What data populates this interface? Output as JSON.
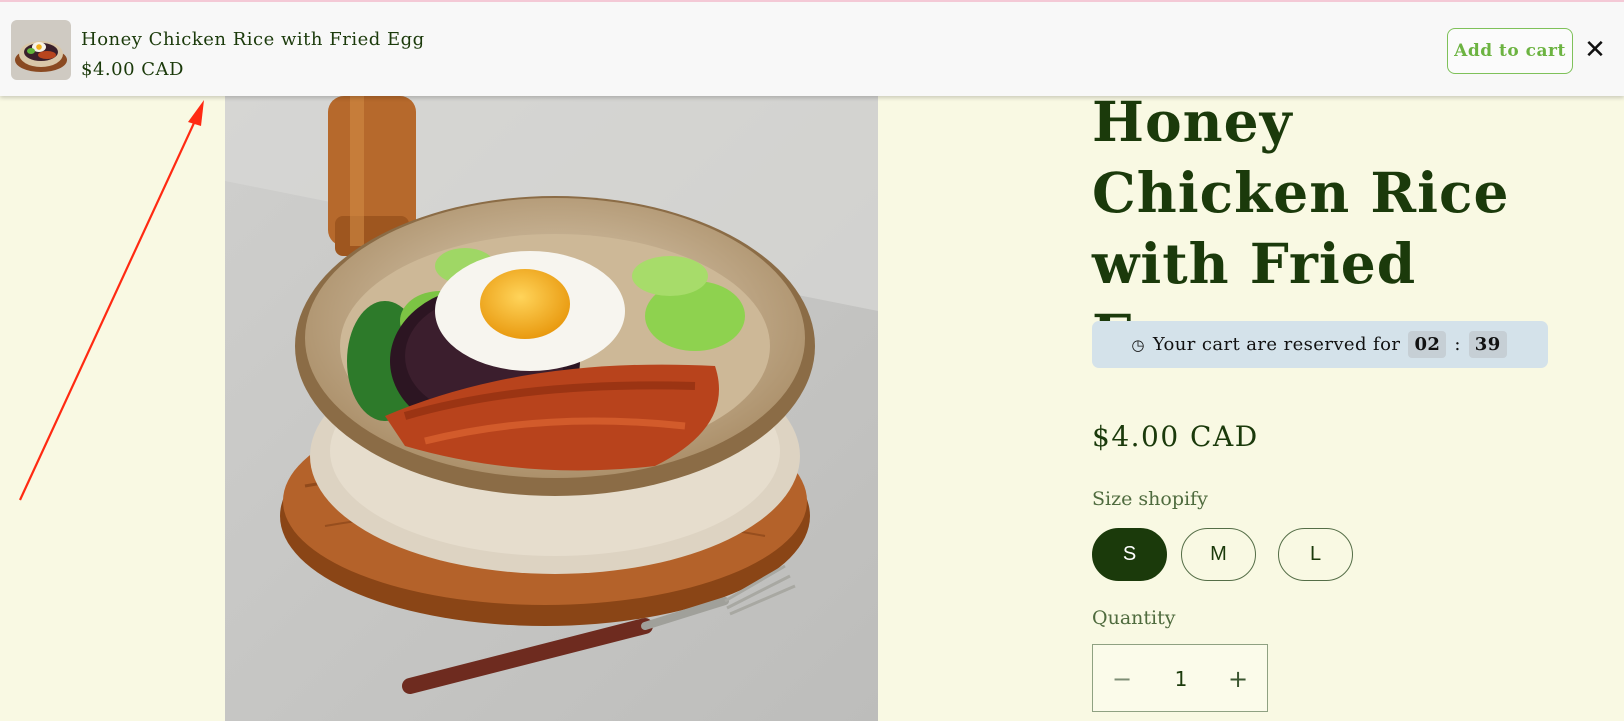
{
  "sticky_bar": {
    "title": "Honey Chicken Rice with Fried Egg",
    "price": "$4.00 CAD",
    "add_to_cart_label": "Add to cart",
    "close_icon": "close-icon",
    "close_glyph": "✕"
  },
  "product": {
    "title": "Honey Chicken Rice with Fried Egg",
    "price": "$4.00 CAD",
    "image_description": "rice-bowl-photo"
  },
  "reservation": {
    "text": "Your cart are reserved for",
    "minutes": "02",
    "separator": ":",
    "seconds": "39",
    "icon": "clock-icon",
    "clock_glyph": "◷"
  },
  "size": {
    "label": "Size shopify",
    "options": [
      "S",
      "M",
      "L"
    ],
    "selected": "S"
  },
  "quantity": {
    "label": "Quantity",
    "value": "1",
    "decrement_glyph": "−",
    "increment_glyph": "+"
  },
  "colors": {
    "background": "#f9f9e3",
    "text_dark_green": "#1b3a0b",
    "accent_green": "#6cb341",
    "reserve_bg": "#d4e2ea",
    "annotation_red": "#ff2a12"
  }
}
